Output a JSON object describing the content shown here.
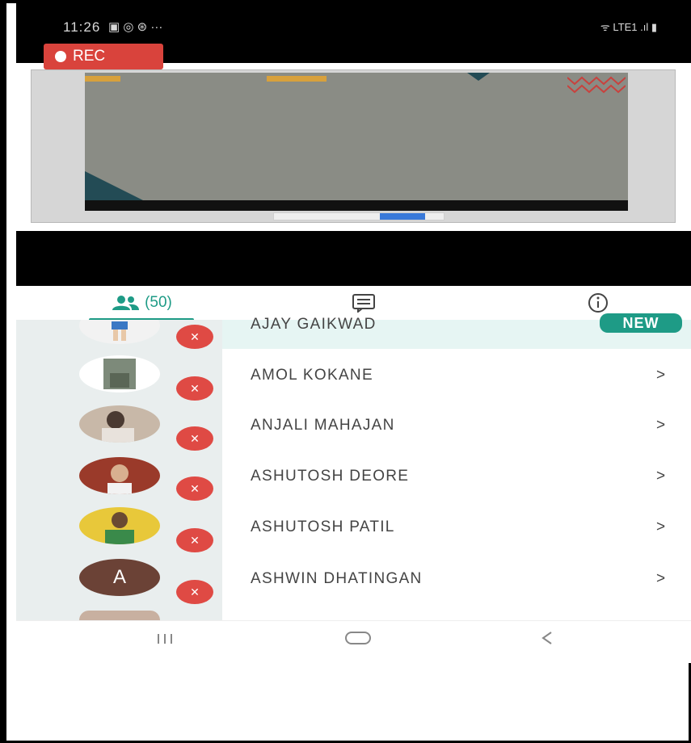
{
  "status_bar": {
    "time": "11:26",
    "icons_left": "▣ ◎ ⊛ ···",
    "icons_right": "ᯤ LTE1 .ıl ▮"
  },
  "recording": {
    "label": "REC"
  },
  "tabs": {
    "participants_count": "(50)"
  },
  "participants": [
    {
      "name": "AJAY GAIKWAD",
      "badge": "NEW",
      "avatar": "photo"
    },
    {
      "name": "AMOL KOKANE",
      "chevron": ">",
      "avatar": "photo"
    },
    {
      "name": "ANJALI MAHAJAN",
      "chevron": ">",
      "avatar": "photo"
    },
    {
      "name": "ASHUTOSH DEORE",
      "chevron": ">",
      "avatar": "photo"
    },
    {
      "name": "ASHUTOSH PATIL",
      "chevron": ">",
      "avatar": "photo"
    },
    {
      "name": "ASHWIN DHATINGAN",
      "chevron": ">",
      "avatar_letter": "A"
    }
  ],
  "colors": {
    "accent": "#1e9b86",
    "mute": "#df4a44",
    "rec": "#d9433c"
  }
}
